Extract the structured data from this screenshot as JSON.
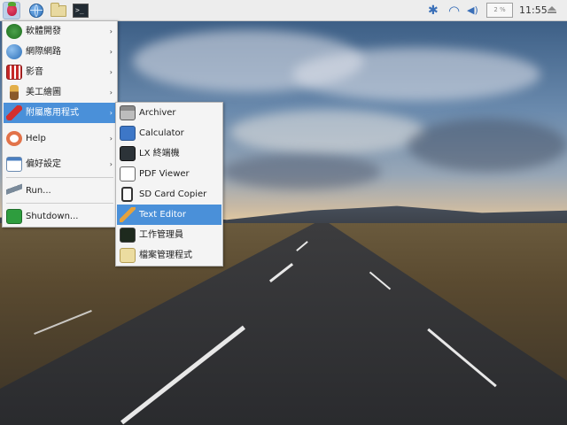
{
  "panel": {
    "clock": "11:55",
    "cpu_label": "2 %",
    "icons": [
      "raspberry-menu-icon",
      "web-browser-icon",
      "file-manager-icon",
      "terminal-icon",
      "bluetooth-icon",
      "wifi-icon",
      "volume-icon",
      "cpu-monitor",
      "eject-icon"
    ],
    "glyphs": {
      "bluetooth": "✱",
      "wifi": "◠",
      "volume": "◀)",
      "terminal": ">_"
    }
  },
  "main_menu": {
    "items": [
      {
        "label": "軟體開發",
        "icon": "programming-icon",
        "submenu": true
      },
      {
        "label": "網際網路",
        "icon": "internet-icon",
        "submenu": true
      },
      {
        "label": "影音",
        "icon": "sound-video-icon",
        "submenu": true
      },
      {
        "label": "美工繪圖",
        "icon": "graphics-icon",
        "submenu": true
      },
      {
        "label": "附屬應用程式",
        "icon": "accessories-icon",
        "submenu": true,
        "selected": true
      },
      {
        "label": "Help",
        "icon": "help-icon",
        "submenu": true
      },
      {
        "label": "偏好設定",
        "icon": "preferences-icon",
        "submenu": true
      },
      {
        "label": "Run...",
        "icon": "run-icon",
        "submenu": false
      },
      {
        "label": "Shutdown...",
        "icon": "shutdown-icon",
        "submenu": false
      }
    ],
    "arrow": "›"
  },
  "sub_menu": {
    "items": [
      {
        "label": "Archiver",
        "icon": "archiver-icon"
      },
      {
        "label": "Calculator",
        "icon": "calculator-icon"
      },
      {
        "label": "LX 終端機",
        "icon": "terminal-icon"
      },
      {
        "label": "PDF Viewer",
        "icon": "pdf-viewer-icon"
      },
      {
        "label": "SD Card Copier",
        "icon": "sd-card-icon"
      },
      {
        "label": "Text Editor",
        "icon": "text-editor-icon",
        "selected": true
      },
      {
        "label": "工作管理員",
        "icon": "task-manager-icon"
      },
      {
        "label": "檔案管理程式",
        "icon": "file-manager-icon"
      }
    ]
  },
  "colors": {
    "selection": "#4a90d9",
    "menu_bg": "#f4f4f4",
    "panel_bg": "#ededed",
    "tray_blue": "#3a6fb8"
  }
}
